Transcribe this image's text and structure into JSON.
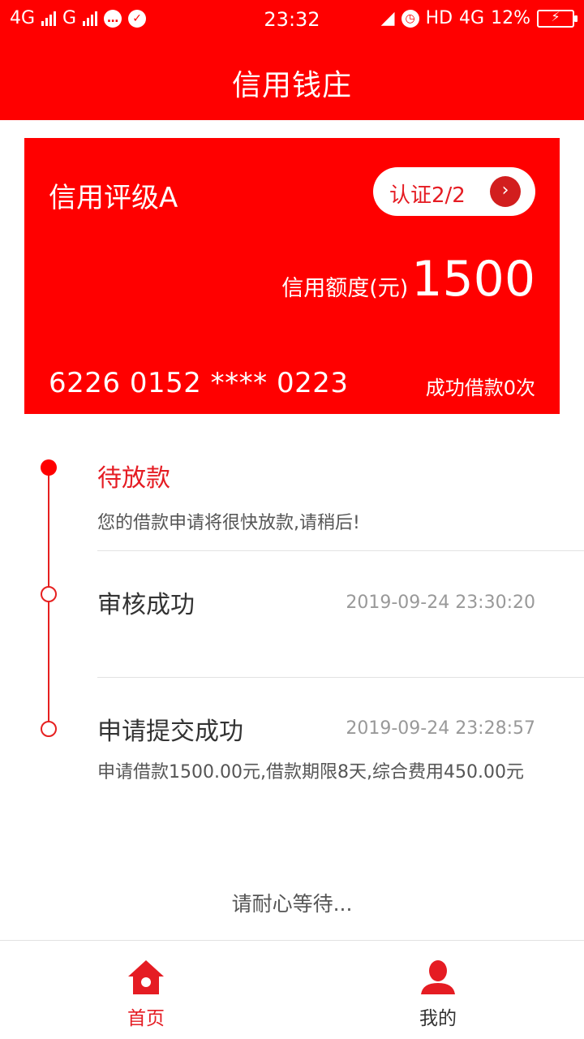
{
  "status_bar": {
    "left_network_1": "4G",
    "left_network_2": "G",
    "time": "23:32",
    "hd": "HD",
    "right_network": "4G",
    "battery": "12%"
  },
  "header": {
    "title": "信用钱庄"
  },
  "card": {
    "rating": "信用评级A",
    "cert_label": "认证2/2",
    "limit_label": "信用额度(元)",
    "limit_value": "1500",
    "card_number": "6226 0152 **** 0223",
    "loan_count": "成功借款0次"
  },
  "timeline": [
    {
      "title": "待放款",
      "desc": "您的借款申请将很快放款,请稍后!",
      "time": ""
    },
    {
      "title": "审核成功",
      "desc": "",
      "time": "2019-09-24 23:30:20"
    },
    {
      "title": "申请提交成功",
      "desc": "申请借款1500.00元,借款期限8天,综合费用450.00元",
      "time": "2019-09-24 23:28:57"
    }
  ],
  "wait_text": "请耐心等待...",
  "bottom_nav": [
    {
      "label": "首页",
      "icon": "home-icon",
      "active": true
    },
    {
      "label": "我的",
      "icon": "user-icon",
      "active": false
    }
  ],
  "colors": {
    "brand_red": "#ff0000",
    "accent_red": "#e51c23",
    "text_gray": "#999999"
  }
}
